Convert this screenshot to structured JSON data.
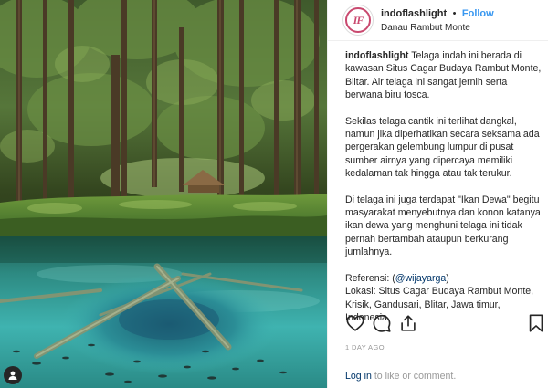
{
  "post": {
    "username": "indoflashlight",
    "separator": "•",
    "follow_label": "Follow",
    "location": "Danau Rambut Monte",
    "avatar_text": "IF"
  },
  "caption": {
    "username": "indoflashlight",
    "p1": "Telaga indah ini berada di kawasan Situs Cagar Budaya Rambut Monte, Blitar. Air telaga ini sangat jernih serta berwana biru tosca.",
    "p2": "Sekilas telaga cantik ini terlihat dangkal, namun jika diperhatikan secara seksama ada pergerakan gelembung lumpur di pusat sumber airnya yang dipercaya memiliki kedalaman tak hingga atau tak terukur.",
    "p3": "Di telaga ini juga terdapat \"Ikan Dewa\" begitu masyarakat menyebutnya dan konon katanya ikan dewa yang menghuni telaga ini tidak pernah bertambah ataupun berkurang jumlahnya.",
    "ref_label": "Referensi: (",
    "ref_mention": "@wijayarga",
    "ref_close": ")",
    "location_line": "Lokasi: Situs Cagar Budaya Rambut Monte, Krisik, Gandusari, Blitar, Jawa timur, Indonesia"
  },
  "timestamp": "1 DAY AGO",
  "comment": {
    "login_label": "Log in",
    "rest": " to like or comment."
  },
  "colors": {
    "link_blue": "#3897f0",
    "mention_blue": "#003569",
    "meta_gray": "#999999",
    "water_turquoise": "#3fb3b0"
  },
  "icons": [
    "heart-icon",
    "comment-icon",
    "share-icon",
    "bookmark-icon",
    "user-tag-icon"
  ]
}
